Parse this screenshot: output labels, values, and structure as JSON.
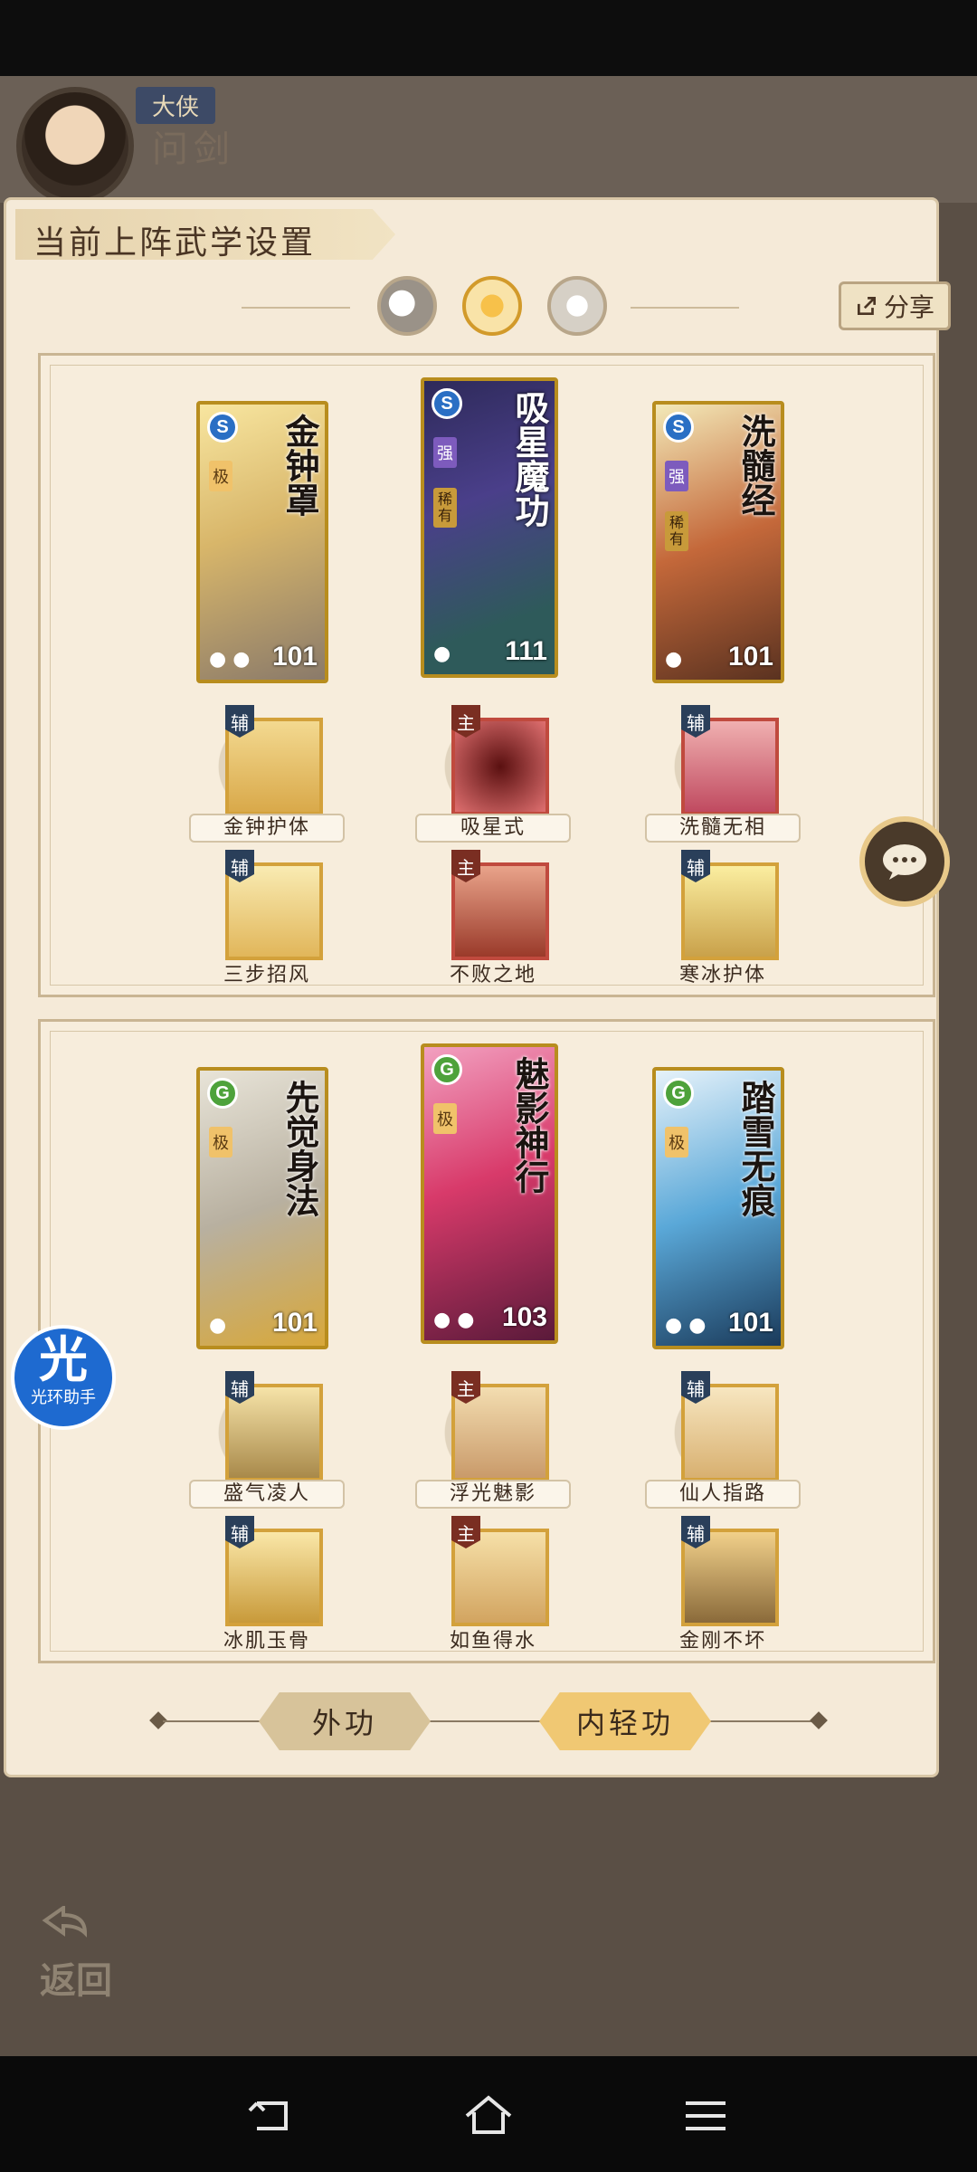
{
  "profile": {
    "rank": "大侠",
    "name": "问剑"
  },
  "panel": {
    "title": "当前上阵武学设置",
    "share_label": "分享"
  },
  "groups": [
    {
      "cards": [
        {
          "name": "金钟罩",
          "level": "101",
          "type": "S",
          "badge": "极",
          "rare": ""
        },
        {
          "name": "吸星魔功",
          "level": "111",
          "type": "S",
          "badge": "强",
          "rare": "稀有"
        },
        {
          "name": "洗髓经",
          "level": "101",
          "type": "S",
          "badge": "强",
          "rare": "稀有"
        }
      ],
      "subs_row1": [
        {
          "tag": "辅",
          "label": "金钟护体"
        },
        {
          "tag": "主",
          "label": "吸星式"
        },
        {
          "tag": "辅",
          "label": "洗髓无相"
        }
      ],
      "subs_row2": [
        {
          "tag": "辅",
          "label": "三步招风"
        },
        {
          "tag": "主",
          "label": "不败之地"
        },
        {
          "tag": "辅",
          "label": "寒冰护体"
        }
      ]
    },
    {
      "cards": [
        {
          "name": "先觉身法",
          "level": "101",
          "type": "G",
          "badge": "极",
          "rare": ""
        },
        {
          "name": "魅影神行",
          "level": "103",
          "type": "G",
          "badge": "极",
          "rare": ""
        },
        {
          "name": "踏雪无痕",
          "level": "101",
          "type": "G",
          "badge": "极",
          "rare": ""
        }
      ],
      "subs_row1": [
        {
          "tag": "辅",
          "label": "盛气凌人"
        },
        {
          "tag": "主",
          "label": "浮光魅影"
        },
        {
          "tag": "辅",
          "label": "仙人指路"
        }
      ],
      "subs_row2": [
        {
          "tag": "辅",
          "label": "冰肌玉骨"
        },
        {
          "tag": "主",
          "label": "如鱼得水"
        },
        {
          "tag": "辅",
          "label": "金刚不坏"
        }
      ]
    }
  ],
  "tabs": {
    "outer": "外功",
    "inner": "内轻功"
  },
  "halo": {
    "char": "光",
    "sub": "光环助手"
  },
  "back_label": "返回",
  "colors": {
    "panel_bg": "#f5ead8",
    "accent_gold": "#f0c873",
    "card_border": "#b88d1e",
    "main_tag": "#7a2e22",
    "aux_tag": "#2a3f5a"
  }
}
